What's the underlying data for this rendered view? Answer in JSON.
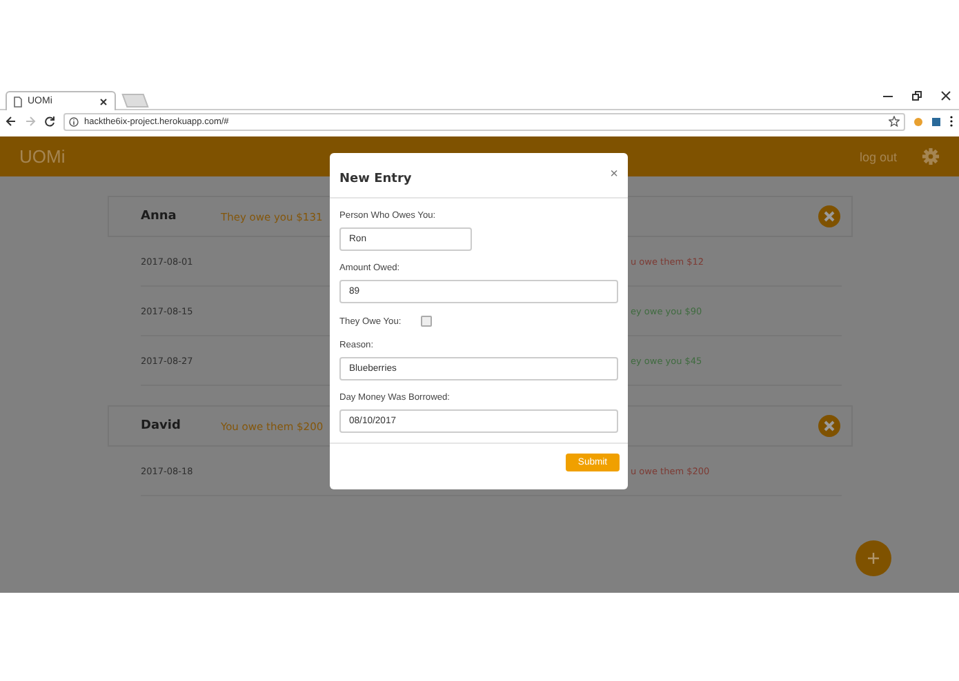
{
  "browser": {
    "tab_title": "UOMi",
    "url": "hackthe6ix-project.herokuapp.com/#"
  },
  "app": {
    "brand": "UOMi",
    "logout": "log out"
  },
  "people": [
    {
      "name": "Anna",
      "summary": "They owe you $131",
      "entries": [
        {
          "date": "2017-08-01",
          "amount": "u owe them $12",
          "color": "#7d3a33"
        },
        {
          "date": "2017-08-15",
          "amount": "ey owe you $90",
          "color": "#3f6b3f"
        },
        {
          "date": "2017-08-27",
          "amount": "ey owe you $45",
          "color": "#3f6b3f"
        }
      ]
    },
    {
      "name": "David",
      "summary": "You owe them $200",
      "entries": [
        {
          "date": "2017-08-18",
          "amount": "u owe them $200",
          "color": "#7d3a33"
        }
      ]
    }
  ],
  "modal": {
    "title": "New Entry",
    "close": "×",
    "fields": [
      {
        "kind": "text",
        "label": "Person Who Owes You:",
        "value": "Ron",
        "short": true
      },
      {
        "kind": "text",
        "label": "Amount Owed:",
        "value": "89"
      },
      {
        "kind": "checkbox",
        "label": "They Owe You:",
        "checked": false
      },
      {
        "kind": "text",
        "label": "Reason:",
        "value": "Blueberries"
      },
      {
        "kind": "text",
        "label": "Day Money Was Borrowed:",
        "value": "08/10/2017"
      }
    ],
    "submit": "Submit"
  }
}
